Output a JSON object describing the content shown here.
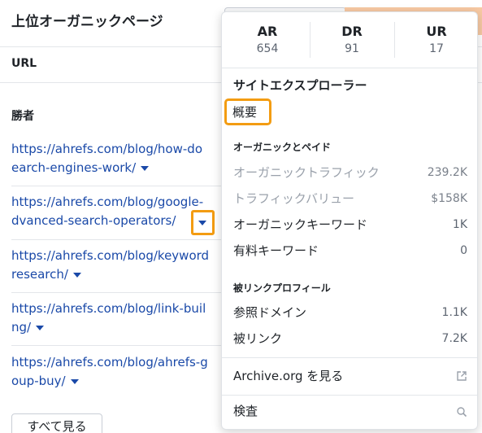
{
  "panel": {
    "title": "上位オーガニックページ",
    "url_label": "URL",
    "winner_label": "勝者",
    "rows": [
      {
        "line1": "https://ahrefs.com/blog/how-do",
        "line2": "earch-engines-work/"
      },
      {
        "line1": "https://ahrefs.com/blog/google-",
        "line2": "dvanced-search-operators/"
      },
      {
        "line1": "https://ahrefs.com/blog/keyword",
        "line2": "research/"
      },
      {
        "line1": "https://ahrefs.com/blog/link-buil",
        "line2": "ng/"
      },
      {
        "line1": "https://ahrefs.com/blog/ahrefs-g",
        "line2": "oup-buy/"
      }
    ],
    "see_all": "すべて見る"
  },
  "dropdown": {
    "metrics": [
      {
        "label": "AR",
        "value": "654"
      },
      {
        "label": "DR",
        "value": "91"
      },
      {
        "label": "UR",
        "value": "17"
      }
    ],
    "section_title": "サイトエクスプローラー",
    "overview": "概要",
    "group1_title": "オーガニックとペイド",
    "group1_items": [
      {
        "label": "オーガニックトラフィック",
        "value": "239.2K",
        "enabled": false
      },
      {
        "label": "トラフィックバリュー",
        "value": "$158K",
        "enabled": false
      },
      {
        "label": "オーガニックキーワード",
        "value": "1K",
        "enabled": true
      },
      {
        "label": "有料キーワード",
        "value": "0",
        "enabled": true
      }
    ],
    "group2_title": "被リンクプロフィール",
    "group2_items": [
      {
        "label": "参照ドメイン",
        "value": "1.1K"
      },
      {
        "label": "被リンク",
        "value": "7.2K"
      }
    ],
    "archive_label": "Archive.org を見る",
    "archive_icon": "external-link-icon",
    "search_label": "検査",
    "search_icon": "search-icon"
  },
  "colors": {
    "link": "#1a49a8",
    "highlight": "#f39c12",
    "header_button_accent": "#f7c9a3"
  }
}
